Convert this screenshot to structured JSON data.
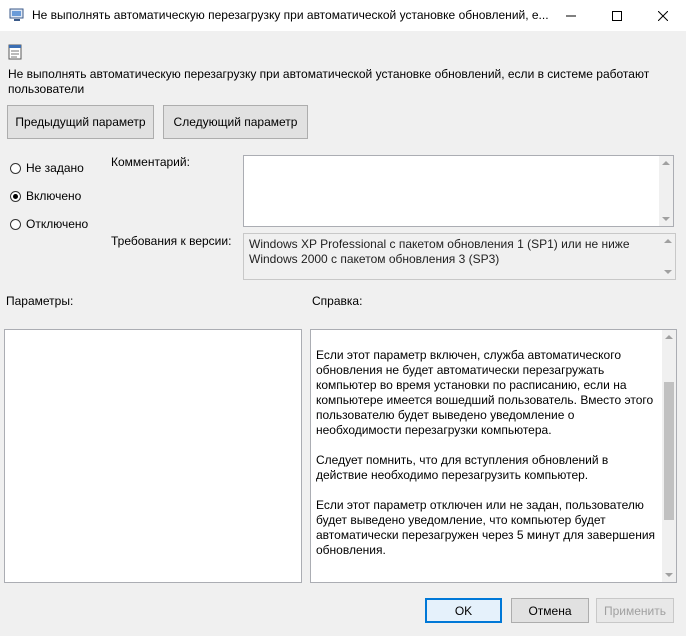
{
  "window": {
    "title": "Не выполнять автоматическую перезагрузку при автоматической установке обновлений, е...",
    "controls": [
      "minimize-icon",
      "maximize-icon",
      "close-icon"
    ]
  },
  "policy": {
    "title": "Не выполнять автоматическую перезагрузку при автоматической установке обновлений, если в системе работают пользователи",
    "prev_button": "Предыдущий параметр",
    "next_button": "Следующий параметр"
  },
  "state": {
    "options": [
      {
        "label": "Не задано",
        "checked": false
      },
      {
        "label": "Включено",
        "checked": true
      },
      {
        "label": "Отключено",
        "checked": false
      }
    ]
  },
  "comment": {
    "label": "Комментарий:",
    "value": ""
  },
  "version": {
    "label": "Требования к версии:",
    "line1": "Windows XP Professional с пакетом обновления 1 (SP1) или не ниже",
    "line2": "Windows 2000 с пакетом обновления 3 (SP3)"
  },
  "panels": {
    "params_label": "Параметры:",
    "help_label": "Справка:",
    "help_paragraphs": [
      "Если этот параметр включен, служба автоматического обновления не будет автоматически перезагружать компьютер во время установки по расписанию, если на компьютере имеется вошедший пользователь. Вместо этого пользователю будет выведено уведомление о необходимости перезагрузки компьютера.",
      "Следует помнить, что для вступления обновлений в действие необходимо перезагрузить компьютер.",
      "Если этот параметр отключен или не задан, пользователю будет выведено уведомление, что компьютер будет автоматически перезагружен через 5 минут для завершения обновления."
    ]
  },
  "footer": {
    "ok": "OK",
    "cancel": "Отмена",
    "apply": "Применить"
  },
  "colors": {
    "accent": "#0078d7",
    "background": "#f0f0f0"
  }
}
